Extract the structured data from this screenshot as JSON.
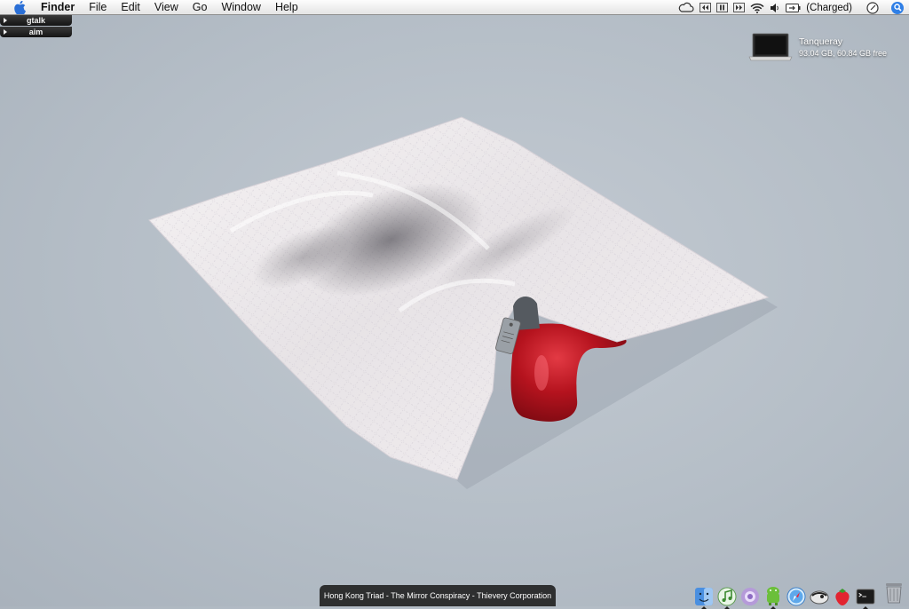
{
  "menubar": {
    "app_name": "Finder",
    "menus": [
      "File",
      "Edit",
      "View",
      "Go",
      "Window",
      "Help"
    ],
    "battery_status": "(Charged)",
    "icons": [
      "apple-icon",
      "cloud-icon",
      "rewind-icon",
      "pause-icon",
      "forward-icon",
      "wifi-icon",
      "volume-icon",
      "battery-icon",
      "clock-icon",
      "spotlight-icon"
    ]
  },
  "tabs": [
    {
      "label": "gtalk"
    },
    {
      "label": "aim"
    }
  ],
  "drive": {
    "name": "Tanqueray",
    "info": "93.04 GB, 60.84 GB free"
  },
  "now_playing": {
    "text": "Hong Kong Triad - The Mirror Conspiracy - Thievery Corporation"
  },
  "dock": {
    "items": [
      "finder-icon",
      "itunes-icon",
      "adium-icon",
      "android-icon",
      "safari-icon",
      "camino-icon",
      "strawberry-icon",
      "terminal-icon"
    ]
  },
  "colors": {
    "accent": "#2f7fe6",
    "blood": "#b3111c",
    "background": "#b7c0c9"
  }
}
